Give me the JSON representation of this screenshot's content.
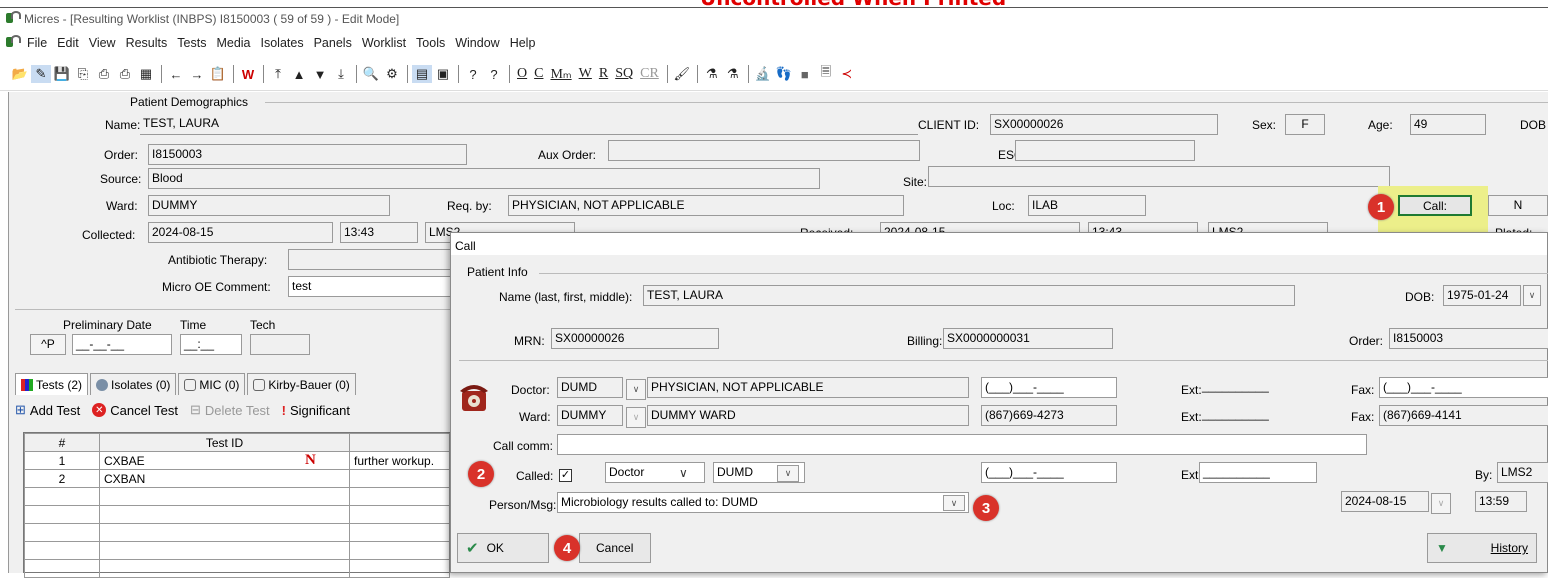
{
  "banner": {
    "text": "Uncontrolled When Printed"
  },
  "window": {
    "title": "Micres - [Resulting Worklist (INBPS) I8150003 ( 59 of 59 ) - Edit Mode]"
  },
  "menu": [
    "File",
    "Edit",
    "View",
    "Results",
    "Tests",
    "Media",
    "Isolates",
    "Panels",
    "Worklist",
    "Tools",
    "Window",
    "Help"
  ],
  "toolbar": {
    "text_buttons": [
      "O",
      "C",
      "Mₘ",
      "W",
      "R",
      "SQ",
      "CR"
    ]
  },
  "demographics": {
    "section": "Patient Demographics",
    "name_label": "Name:",
    "name": "TEST, LAURA",
    "client_id_label": "CLIENT ID:",
    "client_id": "SX00000026",
    "sex_label": "Sex:",
    "sex": "F",
    "age_label": "Age:",
    "age": "49",
    "dob_label": "DOB",
    "order_label": "Order:",
    "order": "I8150003",
    "aux_order_label": "Aux Order:",
    "aux_order": "",
    "eso_label": "ESO:",
    "eso": "",
    "source_label": "Source:",
    "source": "Blood",
    "site_label": "Site:",
    "site": "",
    "ward_label": "Ward:",
    "ward": "DUMMY",
    "reqby_label": "Req. by:",
    "reqby": "PHYSICIAN, NOT APPLICABLE",
    "loc_label": "Loc:",
    "loc": "ILAB",
    "call_button": "Call:",
    "n_field": "N",
    "collected_label": "Collected:",
    "collected_date": "2024-08-15",
    "collected_time": "13:43",
    "collected_tech": "LMS2",
    "received_label": "Received:",
    "received_date": "2024-08-15",
    "received_time": "13:43",
    "received_tech": "LMS2",
    "plated_label": "Plated:",
    "antibiotic_label": "Antibiotic Therapy:",
    "antibiotic": "",
    "micro_oe_label": "Micro OE Comment:",
    "micro_oe": "test"
  },
  "preliminary": {
    "date_label": "Preliminary Date",
    "time_label": "Time",
    "tech_label": "Tech",
    "p_button": "^P",
    "date": "__-__-__",
    "time": "__:__",
    "tech": ""
  },
  "tabs": [
    {
      "label": "Tests (2)"
    },
    {
      "label": "Isolates (0)"
    },
    {
      "label": "MIC (0)"
    },
    {
      "label": "Kirby-Bauer (0)"
    }
  ],
  "actions": {
    "add": "Add Test",
    "cancel": "Cancel Test",
    "delete": "Delete Test",
    "significant": "Significant"
  },
  "tests_grid": {
    "headers": [
      "#",
      "Test ID",
      "",
      ""
    ],
    "rows": [
      [
        "1",
        "CXBAE",
        "N",
        "further workup."
      ],
      [
        "2",
        "CXBAN",
        "",
        ""
      ]
    ]
  },
  "call_dialog": {
    "title": "Call",
    "patient_info": "Patient Info",
    "name_label": "Name (last, first, middle):",
    "name": "TEST, LAURA",
    "dob_label": "DOB:",
    "dob": "1975-01-24",
    "mrn_label": "MRN:",
    "mrn": "SX00000026",
    "billing_label": "Billing:",
    "billing": "SX0000000031",
    "order_label": "Order:",
    "order": "I8150003",
    "doctor_label": "Doctor:",
    "doctor_code": "DUMD",
    "doctor_name": "PHYSICIAN, NOT APPLICABLE",
    "doctor_phone": "(___)___-____",
    "ext_label": "Ext:",
    "doctor_ext": "__________",
    "fax_label": "Fax:",
    "doctor_fax": "(___)___-____",
    "ward_label": "Ward:",
    "ward_code": "DUMMY",
    "ward_name": "DUMMY WARD",
    "ward_phone": "(867)669-4273",
    "ward_ext": "__________",
    "ward_fax": "(867)669-4141",
    "call_comm_label": "Call comm:",
    "call_comm": "",
    "called_label": "Called:",
    "called_type": "Doctor",
    "called_code": "DUMD",
    "called_phone": "(___)___-____",
    "called_ext": "__________",
    "by_label": "By:",
    "by": "LMS2",
    "person_label": "Person/Msg:",
    "person_msg": "Microbiology results called to: DUMD",
    "date": "2024-08-15",
    "time": "13:59",
    "ok": "OK",
    "cancel": "Cancel",
    "history": "History"
  },
  "badges": [
    "1",
    "2",
    "3",
    "4"
  ]
}
